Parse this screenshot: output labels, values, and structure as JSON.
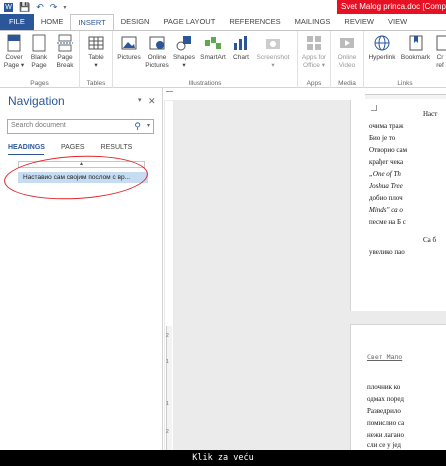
{
  "window": {
    "title": "Svet Malog princa.doc [Compatib"
  },
  "quick_access": {
    "save": "💾",
    "undo": "↶",
    "redo": "↷"
  },
  "tabs": [
    "FILE",
    "HOME",
    "INSERT",
    "DESIGN",
    "PAGE LAYOUT",
    "REFERENCES",
    "MAILINGS",
    "REVIEW",
    "VIEW"
  ],
  "ribbon": {
    "pages": {
      "label": "Pages",
      "cover": "Cover\nPage ▾",
      "blank": "Blank\nPage",
      "break": "Page\nBreak"
    },
    "tables": {
      "label": "Tables",
      "table": "Table\n▾"
    },
    "illustrations": {
      "label": "Illustrations",
      "pictures": "Pictures",
      "online": "Online\nPictures",
      "shapes": "Shapes\n▾",
      "smartart": "SmartArt",
      "chart": "Chart",
      "screenshot": "Screenshot\n▾"
    },
    "apps": {
      "label": "Apps",
      "apps_for_office": "Apps for\nOffice ▾"
    },
    "media": {
      "label": "Media",
      "online_video": "Online\nVideo"
    },
    "links": {
      "label": "Links",
      "hyperlink": "Hyperlink",
      "bookmark": "Bookmark",
      "crossref": "Cr\nref"
    }
  },
  "nav": {
    "title": "Navigation",
    "search_placeholder": "Search document",
    "tabs": [
      "HEADINGS",
      "PAGES",
      "RESULTS"
    ],
    "heading_item": "Наставио сам својим послом с вр..."
  },
  "document": {
    "page1_lines": [
      "Наст",
      "очима траж",
      "Био је то",
      "Отворио сам",
      "крађег чека",
      "„One of Th",
      "Joshua Tree",
      "добио плоч",
      "Minds\" са о",
      "песме на Б с",
      "Са б",
      "увелико пао"
    ],
    "page2_lines": [
      "Свет Мало",
      "плочник ко",
      "одмах поред",
      "Разведрило",
      "помислио са",
      "нежи лагано",
      "сли се у јед"
    ]
  },
  "footer": {
    "caption": "Klik za veću"
  }
}
